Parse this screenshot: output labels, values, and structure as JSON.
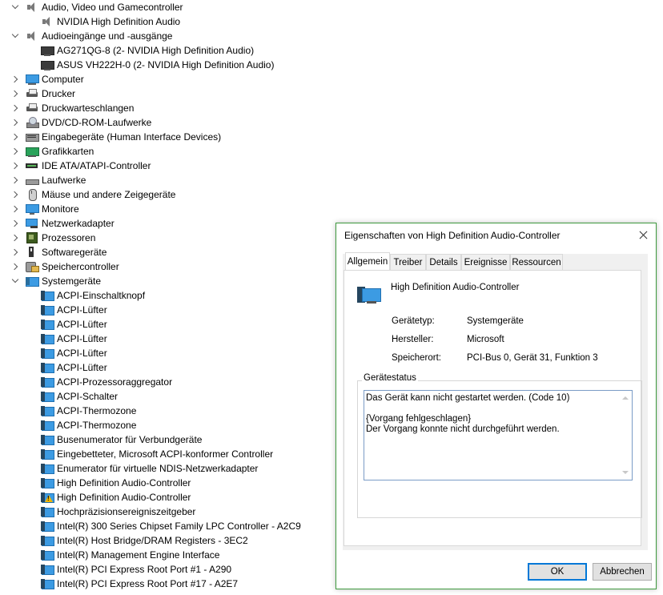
{
  "tree": [
    {
      "label": "Audio, Video und Gamecontroller",
      "level": 0,
      "expander": "down",
      "icon": "speaker-icon"
    },
    {
      "label": "NVIDIA High Definition Audio",
      "level": 1,
      "expander": "none",
      "icon": "speaker-icon"
    },
    {
      "label": "Audioeingänge und -ausgänge",
      "level": 0,
      "expander": "down",
      "icon": "speaker-icon"
    },
    {
      "label": "AG271QG-8 (2- NVIDIA High Definition Audio)",
      "level": 1,
      "expander": "none",
      "icon": "monitor-dark-icon"
    },
    {
      "label": "ASUS VH222H-0 (2- NVIDIA High Definition Audio)",
      "level": 1,
      "expander": "none",
      "icon": "monitor-dark-icon"
    },
    {
      "label": "Computer",
      "level": 0,
      "expander": "right",
      "icon": "computer-icon"
    },
    {
      "label": "Drucker",
      "level": 0,
      "expander": "right",
      "icon": "printer-icon"
    },
    {
      "label": "Druckwarteschlangen",
      "level": 0,
      "expander": "right",
      "icon": "printer-icon"
    },
    {
      "label": "DVD/CD-ROM-Laufwerke",
      "level": 0,
      "expander": "right",
      "icon": "dvd-icon"
    },
    {
      "label": "Eingabegeräte (Human Interface Devices)",
      "level": 0,
      "expander": "right",
      "icon": "hid-icon"
    },
    {
      "label": "Grafikkarten",
      "level": 0,
      "expander": "right",
      "icon": "gpu-icon"
    },
    {
      "label": "IDE ATA/ATAPI-Controller",
      "level": 0,
      "expander": "right",
      "icon": "ide-icon"
    },
    {
      "label": "Laufwerke",
      "level": 0,
      "expander": "right",
      "icon": "drive-icon"
    },
    {
      "label": "Mäuse und andere Zeigegeräte",
      "level": 0,
      "expander": "right",
      "icon": "mouse-icon"
    },
    {
      "label": "Monitore",
      "level": 0,
      "expander": "right",
      "icon": "monitor-icon"
    },
    {
      "label": "Netzwerkadapter",
      "level": 0,
      "expander": "right",
      "icon": "network-icon"
    },
    {
      "label": "Prozessoren",
      "level": 0,
      "expander": "right",
      "icon": "cpu-icon"
    },
    {
      "label": "Softwaregeräte",
      "level": 0,
      "expander": "right",
      "icon": "software-icon"
    },
    {
      "label": "Speichercontroller",
      "level": 0,
      "expander": "right",
      "icon": "storage-icon"
    },
    {
      "label": "Systemgeräte",
      "level": 0,
      "expander": "down",
      "icon": "system-icon"
    },
    {
      "label": "ACPI-Einschaltknopf",
      "level": 1,
      "expander": "none",
      "icon": "system-device-icon"
    },
    {
      "label": "ACPI-Lüfter",
      "level": 1,
      "expander": "none",
      "icon": "system-device-icon"
    },
    {
      "label": "ACPI-Lüfter",
      "level": 1,
      "expander": "none",
      "icon": "system-device-icon"
    },
    {
      "label": "ACPI-Lüfter",
      "level": 1,
      "expander": "none",
      "icon": "system-device-icon"
    },
    {
      "label": "ACPI-Lüfter",
      "level": 1,
      "expander": "none",
      "icon": "system-device-icon"
    },
    {
      "label": "ACPI-Lüfter",
      "level": 1,
      "expander": "none",
      "icon": "system-device-icon"
    },
    {
      "label": "ACPI-Prozessoraggregator",
      "level": 1,
      "expander": "none",
      "icon": "system-device-icon"
    },
    {
      "label": "ACPI-Schalter",
      "level": 1,
      "expander": "none",
      "icon": "system-device-icon"
    },
    {
      "label": "ACPI-Thermozone",
      "level": 1,
      "expander": "none",
      "icon": "system-device-icon"
    },
    {
      "label": "ACPI-Thermozone",
      "level": 1,
      "expander": "none",
      "icon": "system-device-icon"
    },
    {
      "label": "Busenumerator für Verbundgeräte",
      "level": 1,
      "expander": "none",
      "icon": "system-device-icon"
    },
    {
      "label": "Eingebetteter, Microsoft ACPI-konformer Controller",
      "level": 1,
      "expander": "none",
      "icon": "system-device-icon"
    },
    {
      "label": "Enumerator für virtuelle NDIS-Netzwerkadapter",
      "level": 1,
      "expander": "none",
      "icon": "system-device-icon"
    },
    {
      "label": "High Definition Audio-Controller",
      "level": 1,
      "expander": "none",
      "icon": "system-device-icon"
    },
    {
      "label": "High Definition Audio-Controller",
      "level": 1,
      "expander": "none",
      "icon": "system-device-icon",
      "warning": true
    },
    {
      "label": "Hochpräzisionsereigniszeitgeber",
      "level": 1,
      "expander": "none",
      "icon": "system-device-icon"
    },
    {
      "label": "Intel(R) 300 Series Chipset Family LPC Controller - A2C9",
      "level": 1,
      "expander": "none",
      "icon": "system-device-icon"
    },
    {
      "label": "Intel(R) Host Bridge/DRAM Registers - 3EC2",
      "level": 1,
      "expander": "none",
      "icon": "system-device-icon"
    },
    {
      "label": "Intel(R) Management Engine Interface",
      "level": 1,
      "expander": "none",
      "icon": "system-device-icon"
    },
    {
      "label": "Intel(R) PCI Express Root Port #1 - A290",
      "level": 1,
      "expander": "none",
      "icon": "system-device-icon"
    },
    {
      "label": "Intel(R) PCI Express Root Port #17 - A2E7",
      "level": 1,
      "expander": "none",
      "icon": "system-device-icon"
    }
  ],
  "dialog": {
    "title": "Eigenschaften von High Definition Audio-Controller",
    "tabs": [
      "Allgemein",
      "Treiber",
      "Details",
      "Ereignisse",
      "Ressourcen"
    ],
    "active_tab": "Allgemein",
    "device_name": "High Definition Audio-Controller",
    "props": [
      {
        "key": "Gerätetyp:",
        "value": "Systemgeräte"
      },
      {
        "key": "Hersteller:",
        "value": "Microsoft"
      },
      {
        "key": "Speicherort:",
        "value": "PCI-Bus 0, Gerät 31, Funktion 3"
      }
    ],
    "status_label": "Gerätestatus",
    "status_lines": [
      "Das Gerät kann nicht gestartet werden. (Code 10)",
      "",
      "{Vorgang fehlgeschlagen}",
      "Der Vorgang konnte nicht durchgeführt werden."
    ],
    "ok_label": "OK",
    "cancel_label": "Abbrechen"
  }
}
